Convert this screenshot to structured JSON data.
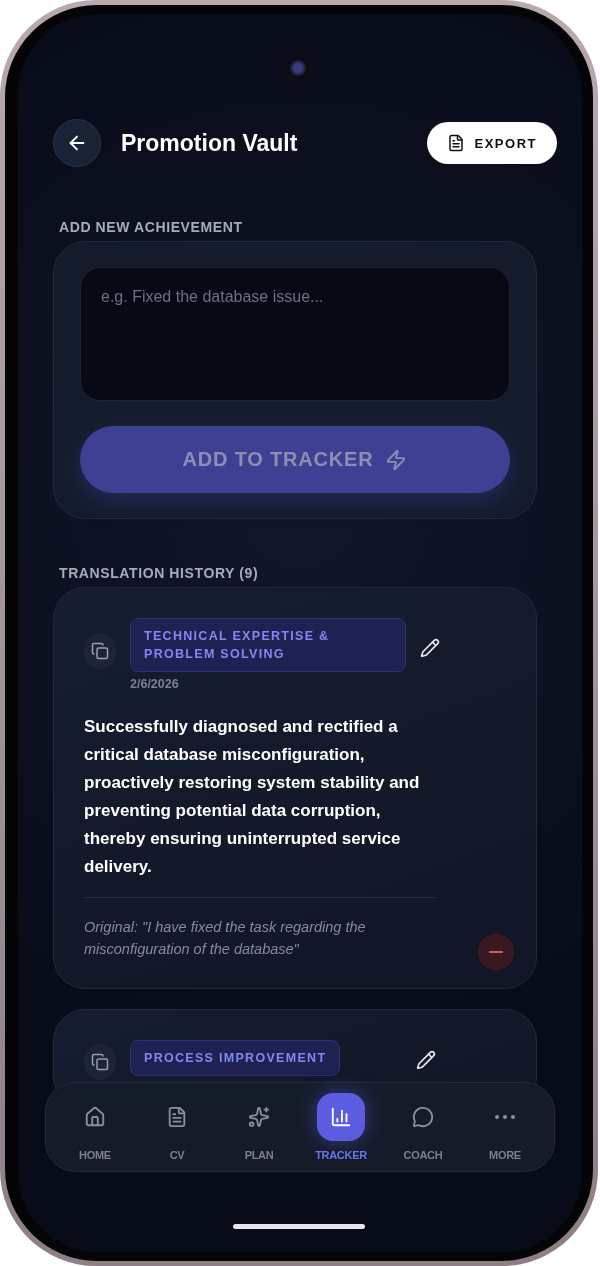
{
  "header": {
    "title": "Promotion Vault",
    "export_label": "EXPORT"
  },
  "add_section": {
    "label": "ADD NEW ACHIEVEMENT",
    "placeholder": "e.g. Fixed the database issue...",
    "button": "ADD TO TRACKER"
  },
  "history": {
    "label": "TRANSLATION HISTORY (9)",
    "entries": [
      {
        "category": "TECHNICAL EXPERTISE & PROBLEM SOLVING",
        "date": "2/6/2026",
        "text": "Successfully diagnosed and rectified a critical database misconfiguration, proactively restoring system stability and preventing potential data corruption, thereby ensuring uninterrupted service delivery.",
        "original": "Original: \"I have fixed the task regarding the misconfiguration of the database\""
      },
      {
        "category": "PROCESS IMPROVEMENT"
      }
    ]
  },
  "nav": [
    {
      "kind": "home",
      "label": "HOME",
      "selected": false
    },
    {
      "kind": "cv",
      "label": "CV",
      "selected": false
    },
    {
      "kind": "plan",
      "label": "PLAN",
      "selected": false
    },
    {
      "kind": "tracker",
      "label": "TRACKER",
      "selected": true
    },
    {
      "kind": "coach",
      "label": "COACH",
      "selected": false
    },
    {
      "kind": "more",
      "label": "MORE",
      "selected": false
    }
  ]
}
